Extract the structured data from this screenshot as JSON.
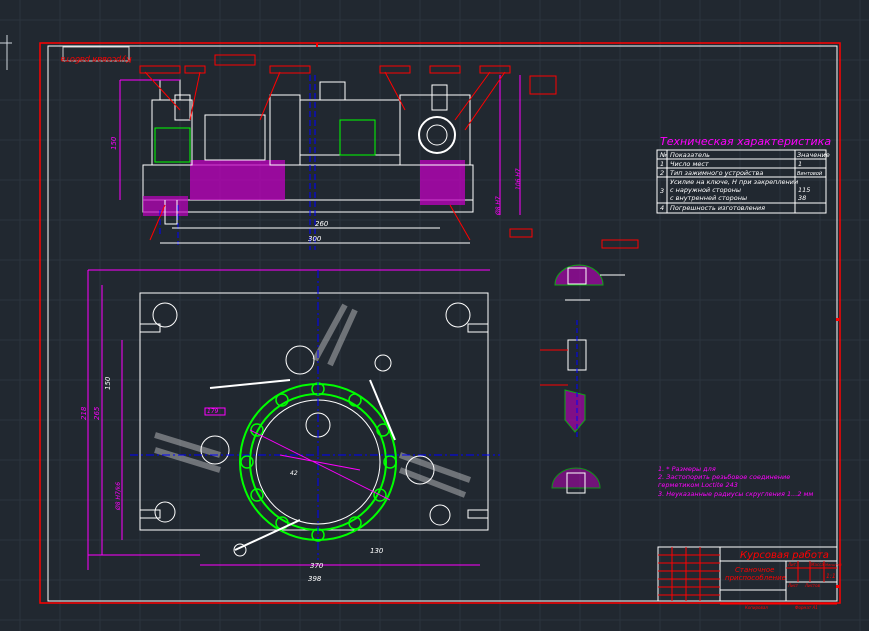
{
  "colors": {
    "background": "#212830",
    "frame": "#ffffff",
    "red": "#ff0000",
    "magenta": "#ff00ff",
    "green": "#00ff00",
    "blue": "#0000ff",
    "yellow": "#ffff00"
  },
  "stamp_top_left": "Курсовая работа",
  "tech": {
    "title": "Техническая характеристика",
    "headers": [
      "№",
      "Показатель",
      "Значение"
    ],
    "rows": [
      {
        "n": "1",
        "name": "Число мест",
        "value": "1"
      },
      {
        "n": "2",
        "name": "Тип зажимного устройства",
        "value": "Винтовой"
      },
      {
        "n": "3",
        "name": "Усилие на ключе, Н  при закреплении",
        "value": ""
      },
      {
        "n": "",
        "name": "с наружной стороны",
        "value": "115"
      },
      {
        "n": "",
        "name": "с внутренней стороны",
        "value": "38"
      },
      {
        "n": "4",
        "name": "Погрешность изготовления",
        "value": ""
      }
    ]
  },
  "notes": [
    "1. *  Размеры для",
    "2. Застопорить резьбовое соединение",
    "герметиком Loctite 243",
    "3. Неуказанные радиусы скругления 1...2 мм"
  ],
  "title_block": {
    "work": "Курсовая работа",
    "name_line1": "Станочное",
    "name_line2": "приспособление",
    "scale": "1:1",
    "lit": "Лит.",
    "mass": "Масса",
    "scale_label": "Масштаб",
    "sheet": "Лист",
    "sheets": "Листов",
    "format": "Формат  А1",
    "copied": "Копировал"
  },
  "dims": {
    "top_width_inner": "260",
    "top_width_outer": "300",
    "top_height": "150",
    "plan_width_inner": "370",
    "plan_width_outer": "398",
    "plan_130": "130",
    "plan_height_outer": "218",
    "plan_height_inner": "265",
    "plan_150": "150",
    "plan_179": "179",
    "plan_42": "42",
    "fit_1": "Ø8 H7/k6",
    "fit_2": "Ø8 H7",
    "fit_3": "106 H7"
  }
}
